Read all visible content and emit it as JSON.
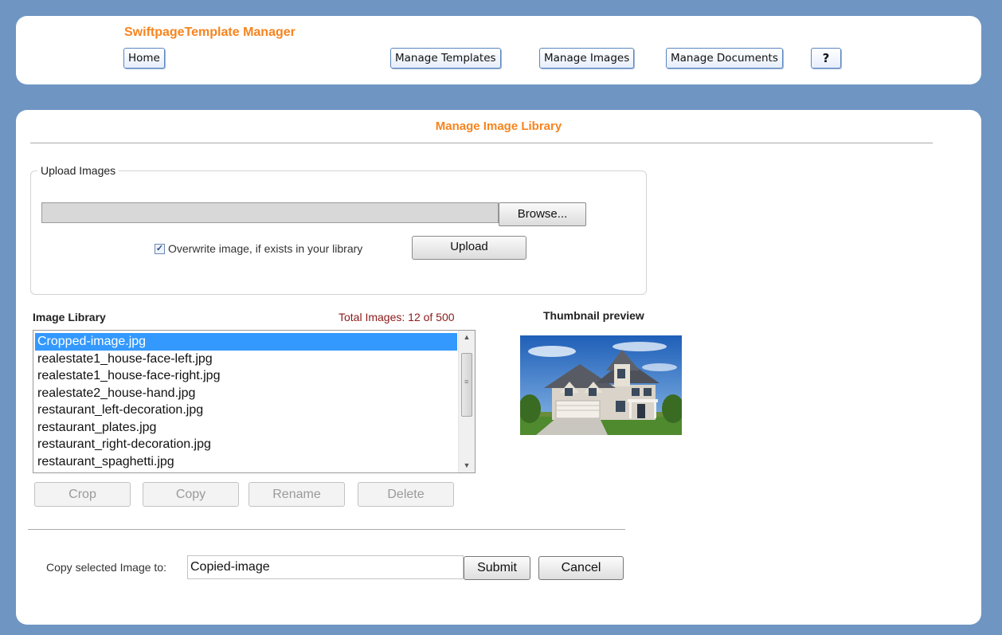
{
  "header": {
    "app_title": "SwiftpageTemplate Manager",
    "nav": {
      "home": "Home",
      "manage_templates": "Manage Templates",
      "manage_images": "Manage Images",
      "manage_documents": "Manage Documents",
      "help": "?"
    }
  },
  "main": {
    "title": "Manage Image Library",
    "upload": {
      "legend": "Upload Images",
      "file_value": "",
      "browse_label": "Browse...",
      "overwrite_checked": true,
      "overwrite_label": "Overwrite image, if exists in your library",
      "upload_label": "Upload"
    },
    "library": {
      "label": "Image Library",
      "total_images": "Total Images: 12 of 500",
      "selected_index": 0,
      "items": [
        "Cropped-image.jpg",
        "realestate1_house-face-left.jpg",
        "realestate1_house-face-right.jpg",
        "realestate2_house-hand.jpg",
        "restaurant_left-decoration.jpg",
        "restaurant_plates.jpg",
        "restaurant_right-decoration.jpg",
        "restaurant_spaghetti.jpg"
      ],
      "actions": {
        "crop": "Crop",
        "copy": "Copy",
        "rename": "Rename",
        "delete": "Delete"
      }
    },
    "thumbnail": {
      "label": "Thumbnail preview"
    },
    "copy_form": {
      "label": "Copy selected Image to:",
      "value": "Copied-image",
      "submit_label": "Submit",
      "cancel_label": "Cancel"
    }
  },
  "colors": {
    "background": "#6f95c3",
    "accent_orange": "#f7841e",
    "selection_blue": "#3399ff",
    "total_images_red": "#8b1a1a"
  }
}
